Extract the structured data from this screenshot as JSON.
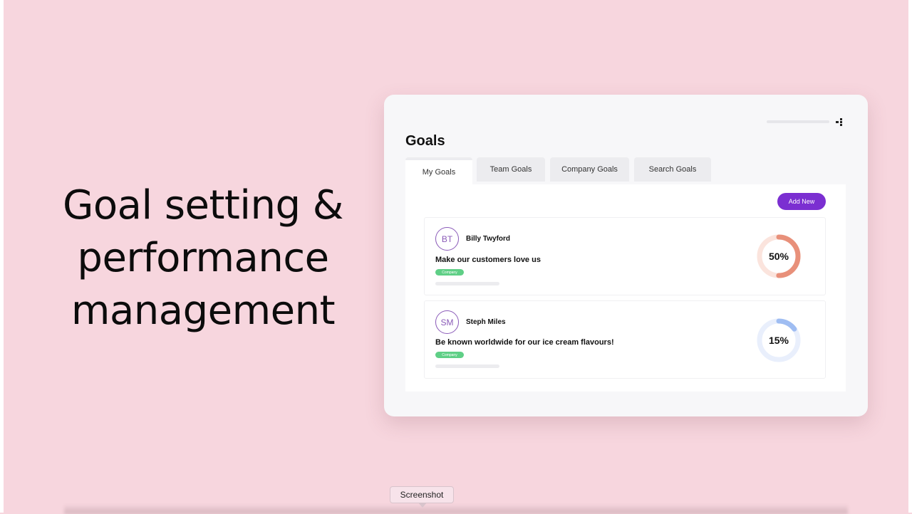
{
  "headline": [
    "Goal setting &",
    "performance",
    "management"
  ],
  "app": {
    "title": "Goals",
    "tabs": [
      {
        "label": "My Goals",
        "active": true
      },
      {
        "label": "Team Goals",
        "active": false
      },
      {
        "label": "Company Goals",
        "active": false
      },
      {
        "label": "Search Goals",
        "active": false
      }
    ],
    "add_button": "Add New",
    "accent_color": "#7b2fd1",
    "goals": [
      {
        "initials": "BT",
        "owner": "Billy Twyford",
        "title": "Make our customers love us",
        "tag": "Company",
        "progress_label": "50%",
        "progress": 0.5,
        "ring_color": "#e8907a",
        "ring_track_color": "#fbe4dd"
      },
      {
        "initials": "SM",
        "owner": "Steph Miles",
        "title": "Be known worldwide for our ice cream flavours!",
        "tag": "Company",
        "progress_label": "15%",
        "progress": 0.15,
        "ring_color": "#9fbdf2",
        "ring_track_color": "#e9effc"
      }
    ]
  },
  "tooltip": "Screenshot"
}
